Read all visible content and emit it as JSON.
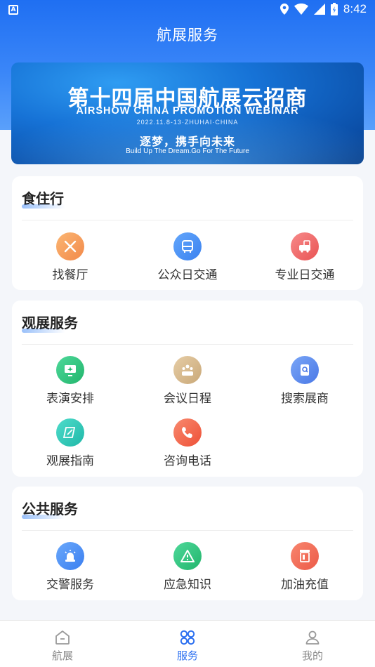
{
  "status": {
    "time": "8:42"
  },
  "header": {
    "title": "航展服务"
  },
  "banner": {
    "title": "第十四届中国航展云招商",
    "subtitle_en": "AIRSHOW CHINA PROMOTION WEBINAR",
    "date": "2022.11.8-13·ZHUHAI·CHINA",
    "slogan": "逐梦，携手向未来",
    "slogan_en": "Build Up The Dream.Go For The Future"
  },
  "sections": [
    {
      "title": "食住行",
      "items": [
        {
          "label": "找餐厅",
          "icon": "restaurant-icon",
          "color": "#f7a35a"
        },
        {
          "label": "公众日交通",
          "icon": "bus-icon",
          "color": "#4c93f5"
        },
        {
          "label": "专业日交通",
          "icon": "shuttle-icon",
          "color": "#f26b6b"
        }
      ]
    },
    {
      "title": "观展服务",
      "items": [
        {
          "label": "表演安排",
          "icon": "airshow-performance-icon",
          "color": "#2fc57e"
        },
        {
          "label": "会议日程",
          "icon": "meeting-icon",
          "color": "#d2b48c"
        },
        {
          "label": "搜索展商",
          "icon": "exhibitor-search-icon",
          "color": "#5b8df0"
        },
        {
          "label": "观展指南",
          "icon": "guide-icon",
          "color": "#2ec8b9"
        },
        {
          "label": "咨询电话",
          "icon": "phone-icon",
          "color": "#f4664f"
        }
      ]
    },
    {
      "title": "公共服务",
      "items": [
        {
          "label": "交警服务",
          "icon": "police-siren-icon",
          "color": "#4c93f5"
        },
        {
          "label": "应急知识",
          "icon": "warning-icon",
          "color": "#2fc57e"
        },
        {
          "label": "加油充值",
          "icon": "fuel-icon",
          "color": "#f46b5a"
        }
      ]
    }
  ],
  "tabs": [
    {
      "label": "航展",
      "icon": "home-icon",
      "active": false
    },
    {
      "label": "服务",
      "icon": "services-icon",
      "active": true
    },
    {
      "label": "我的",
      "icon": "profile-icon",
      "active": false
    }
  ]
}
